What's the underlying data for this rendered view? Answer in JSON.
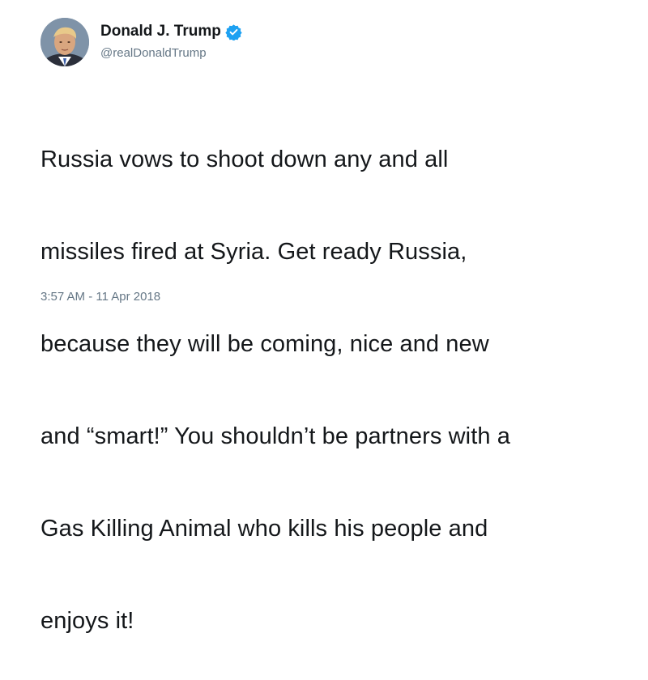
{
  "user": {
    "display_name": "Donald J. Trump",
    "handle": "@realDonaldTrump",
    "verified_icon": "verified-badge-icon",
    "verified_color": "#1da1f2"
  },
  "tweet": {
    "text_lines": [
      "Russia vows to shoot down any and all",
      "missiles fired at Syria. Get ready Russia,",
      "because they will be coming, nice and new",
      "and “smart!” You shouldn’t be partners with a",
      "Gas Killing Animal who kills his people and",
      "enjoys it!"
    ],
    "timestamp": "3:57 AM - 11 Apr 2018"
  }
}
